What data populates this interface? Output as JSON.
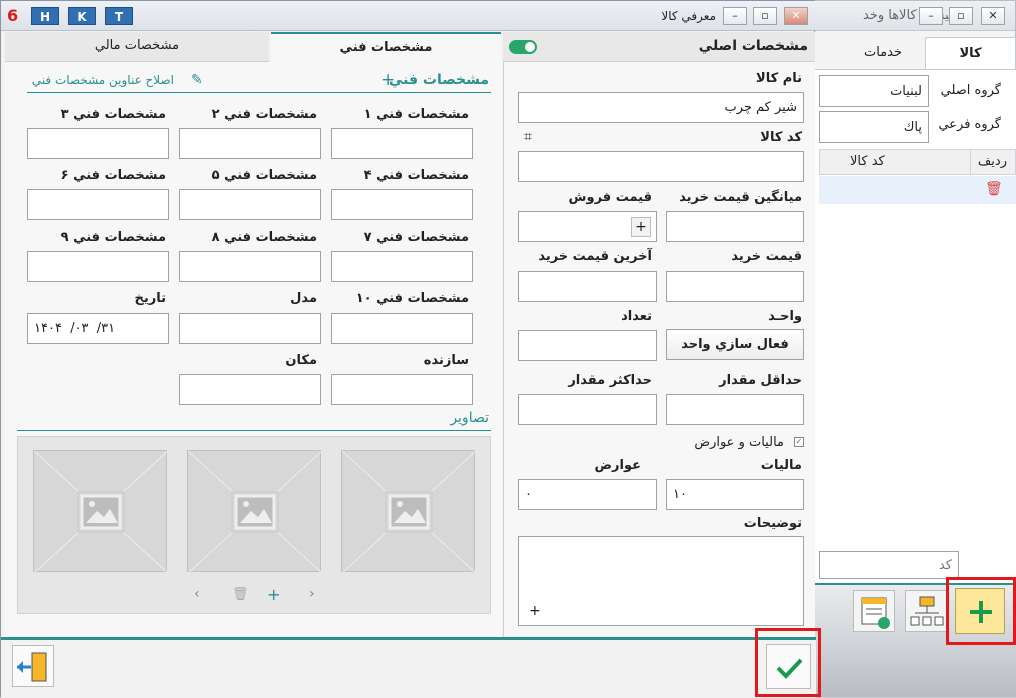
{
  "bg_window": {
    "title": "ليست كالاها وخد",
    "tabs": [
      "كالا",
      "خدمات"
    ],
    "group_main_label": "گروه اصلي",
    "group_main_value": "لبنيات",
    "group_sub_label": "گروه فرعي",
    "group_sub_value": "پاك",
    "col_row": "رديف",
    "col_code": "كد كالا",
    "search_placeholder": "كد"
  },
  "window": {
    "title": "معرفي كالا",
    "hkt": [
      "H",
      "K",
      "T"
    ]
  },
  "left_tabs": {
    "tech": "مشخصات فني",
    "finance": "مشخصات مالي"
  },
  "right_header": "مشخصات اصلي",
  "tech": {
    "header": "مشخصات فني",
    "add": "+",
    "edit_link": "اصلاح عناوين مشخصات فني",
    "labels": [
      "مشخصات فني ۱",
      "مشخصات فني ۲",
      "مشخصات فني ۳",
      "مشخصات فني ۴",
      "مشخصات فني ۵",
      "مشخصات فني ۶",
      "مشخصات فني ۷",
      "مشخصات فني ۸",
      "مشخصات فني ۹",
      "مشخصات فني ۱۰",
      "مدل",
      "تاريخ",
      "سازنده",
      "مکان"
    ],
    "date_value": "۱۴۰۴  /۰۳  /۳۱",
    "images_label": "تصاوير"
  },
  "main": {
    "name_label": "نام كالا",
    "name_value": "شير كم چرب",
    "code_label": "كد كالا",
    "avg_buy_label": "ميانگين قيمت خريد",
    "sell_price_label": "قيمت فروش",
    "buy_price_label": "قيمت خريد",
    "last_buy_label": "آخرين قيمت خريد",
    "unit_label": "واحـد",
    "count_label": "تعداد",
    "unit_btn": "فعال سازي واحد",
    "min_label": "حداقل مقدار",
    "max_label": "حداكثر مقدار",
    "tax_check_label": "ماليات و عوارض",
    "tax_label": "ماليات",
    "duty_label": "عوارض",
    "tax_value": "۱۰",
    "duty_value": "۰",
    "desc_label": "توضيحات"
  },
  "colors": {
    "accent": "#2a8f8f",
    "highlight": "#e0191b",
    "ok": "#1a9a4a"
  }
}
